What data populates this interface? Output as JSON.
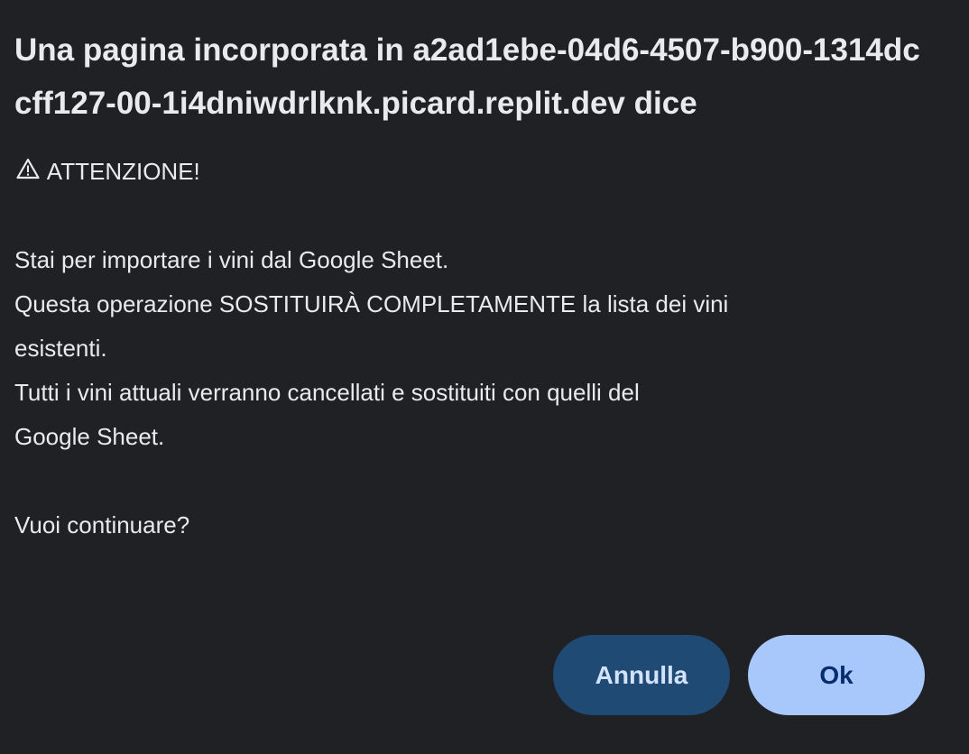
{
  "dialog": {
    "title": "Una pagina incorporata in a2ad1ebe-04d6-4507-b900-1314dccff127-00-1i4dniwdrlknk.picard.replit.dev dice",
    "warning_icon": "warning-triangle-icon",
    "warning_text": "ATTENZIONE!",
    "lines": [
      "",
      "Stai per importare i vini dal Google Sheet.",
      "Questa operazione SOSTITUIRÀ COMPLETAMENTE la lista dei vini",
      "esistenti.",
      "Tutti i vini attuali verranno cancellati e sostituiti con quelli del",
      "Google Sheet.",
      "",
      "Vuoi continuare?"
    ],
    "cancel_label": "Annulla",
    "ok_label": "Ok"
  },
  "colors": {
    "background": "#202124",
    "text": "#e8eaed",
    "cancel_bg": "#1f4a74",
    "ok_bg": "#a8c7fa"
  }
}
